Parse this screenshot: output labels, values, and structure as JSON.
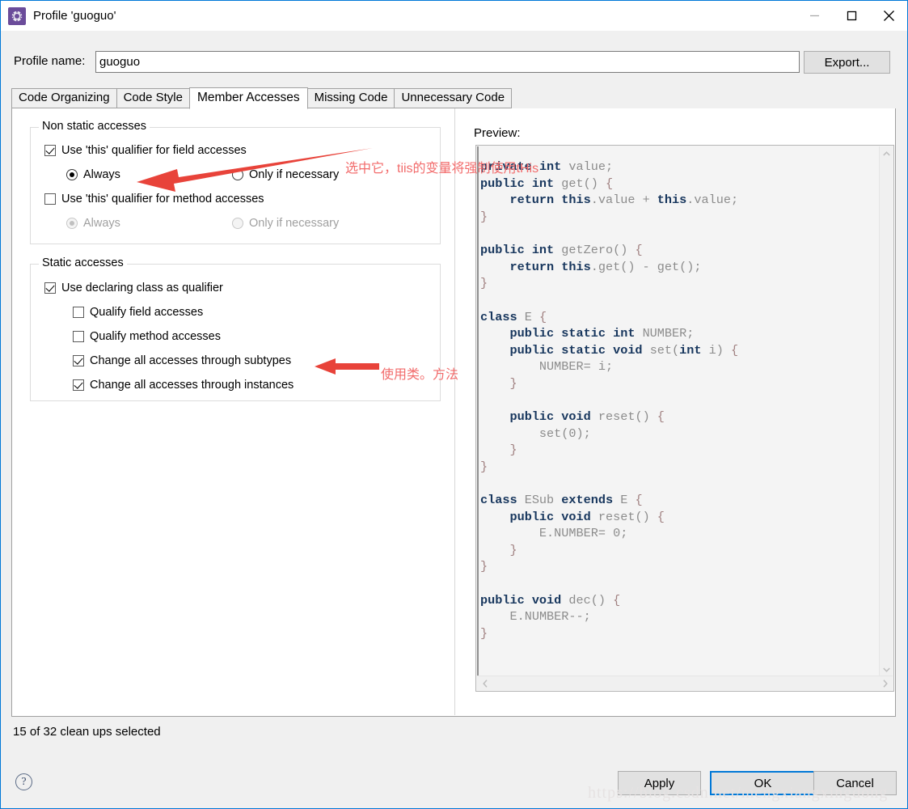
{
  "window": {
    "title": "Profile 'guoguo'",
    "icon": "profile-gear-icon",
    "minimize": "minimize-icon",
    "maximize": "maximize-icon",
    "close": "close-icon",
    "accent_color": "#0078d7"
  },
  "profile": {
    "label": "Profile name:",
    "value": "guoguo",
    "placeholder": "",
    "export_label": "Export..."
  },
  "tabs": [
    {
      "label": "Code Organizing",
      "active": false
    },
    {
      "label": "Code Style",
      "active": false
    },
    {
      "label": "Member Accesses",
      "active": true
    },
    {
      "label": "Missing Code",
      "active": false
    },
    {
      "label": "Unnecessary Code",
      "active": false
    }
  ],
  "non_static": {
    "title": "Non static accesses",
    "field_checkbox": {
      "label": "Use 'this' qualifier for field accesses",
      "checked": true
    },
    "field_always": {
      "label": "Always",
      "selected": true,
      "enabled": true
    },
    "field_only_if_necessary": {
      "label": "Only if necessary",
      "selected": false,
      "enabled": true
    },
    "method_checkbox": {
      "label": "Use 'this' qualifier for method accesses",
      "checked": false
    },
    "method_always": {
      "label": "Always",
      "selected": true,
      "enabled": false
    },
    "method_only_if_necessary": {
      "label": "Only if necessary",
      "selected": false,
      "enabled": false
    }
  },
  "static_accesses": {
    "title": "Static accesses",
    "declaring_class": {
      "label": "Use declaring class as qualifier",
      "checked": true
    },
    "qualify_field": {
      "label": "Qualify field accesses",
      "checked": false
    },
    "qualify_method": {
      "label": "Qualify method accesses",
      "checked": false
    },
    "subtypes": {
      "label": "Change all accesses through subtypes",
      "checked": true
    },
    "instances": {
      "label": "Change all accesses through instances",
      "checked": true
    }
  },
  "preview": {
    "label": "Preview:",
    "code_lines": [
      "private int value;",
      "public int get() {",
      "    return this.value + this.value;",
      "}",
      "",
      "public int getZero() {",
      "    return this.get() - get();",
      "}",
      "",
      "class E {",
      "    public static int NUMBER;",
      "    public static void set(int i) {",
      "        NUMBER= i;",
      "    }",
      "",
      "    public void reset() {",
      "        set(0);",
      "    }",
      "}",
      "",
      "class ESub extends E {",
      "    public void reset() {",
      "        E.NUMBER= 0;",
      "    }",
      "}",
      "",
      "public void dec() {",
      "    E.NUMBER--;",
      "}"
    ],
    "scroll_up": "scroll-up-icon",
    "scroll_down": "scroll-down-icon",
    "scroll_left": "scroll-left-icon",
    "scroll_right": "scroll-right-icon"
  },
  "footer": {
    "status": "15 of 32 clean ups selected",
    "help": "?",
    "apply": "Apply",
    "ok": "OK",
    "cancel": "Cancel"
  },
  "annotations": {
    "note1": "选中它，tiis的变量将强制使用tHis",
    "note2": "使用类。方法",
    "color": "#f26b6b",
    "watermark": "https://blog.csdn.net/mengxiangxingdong"
  }
}
